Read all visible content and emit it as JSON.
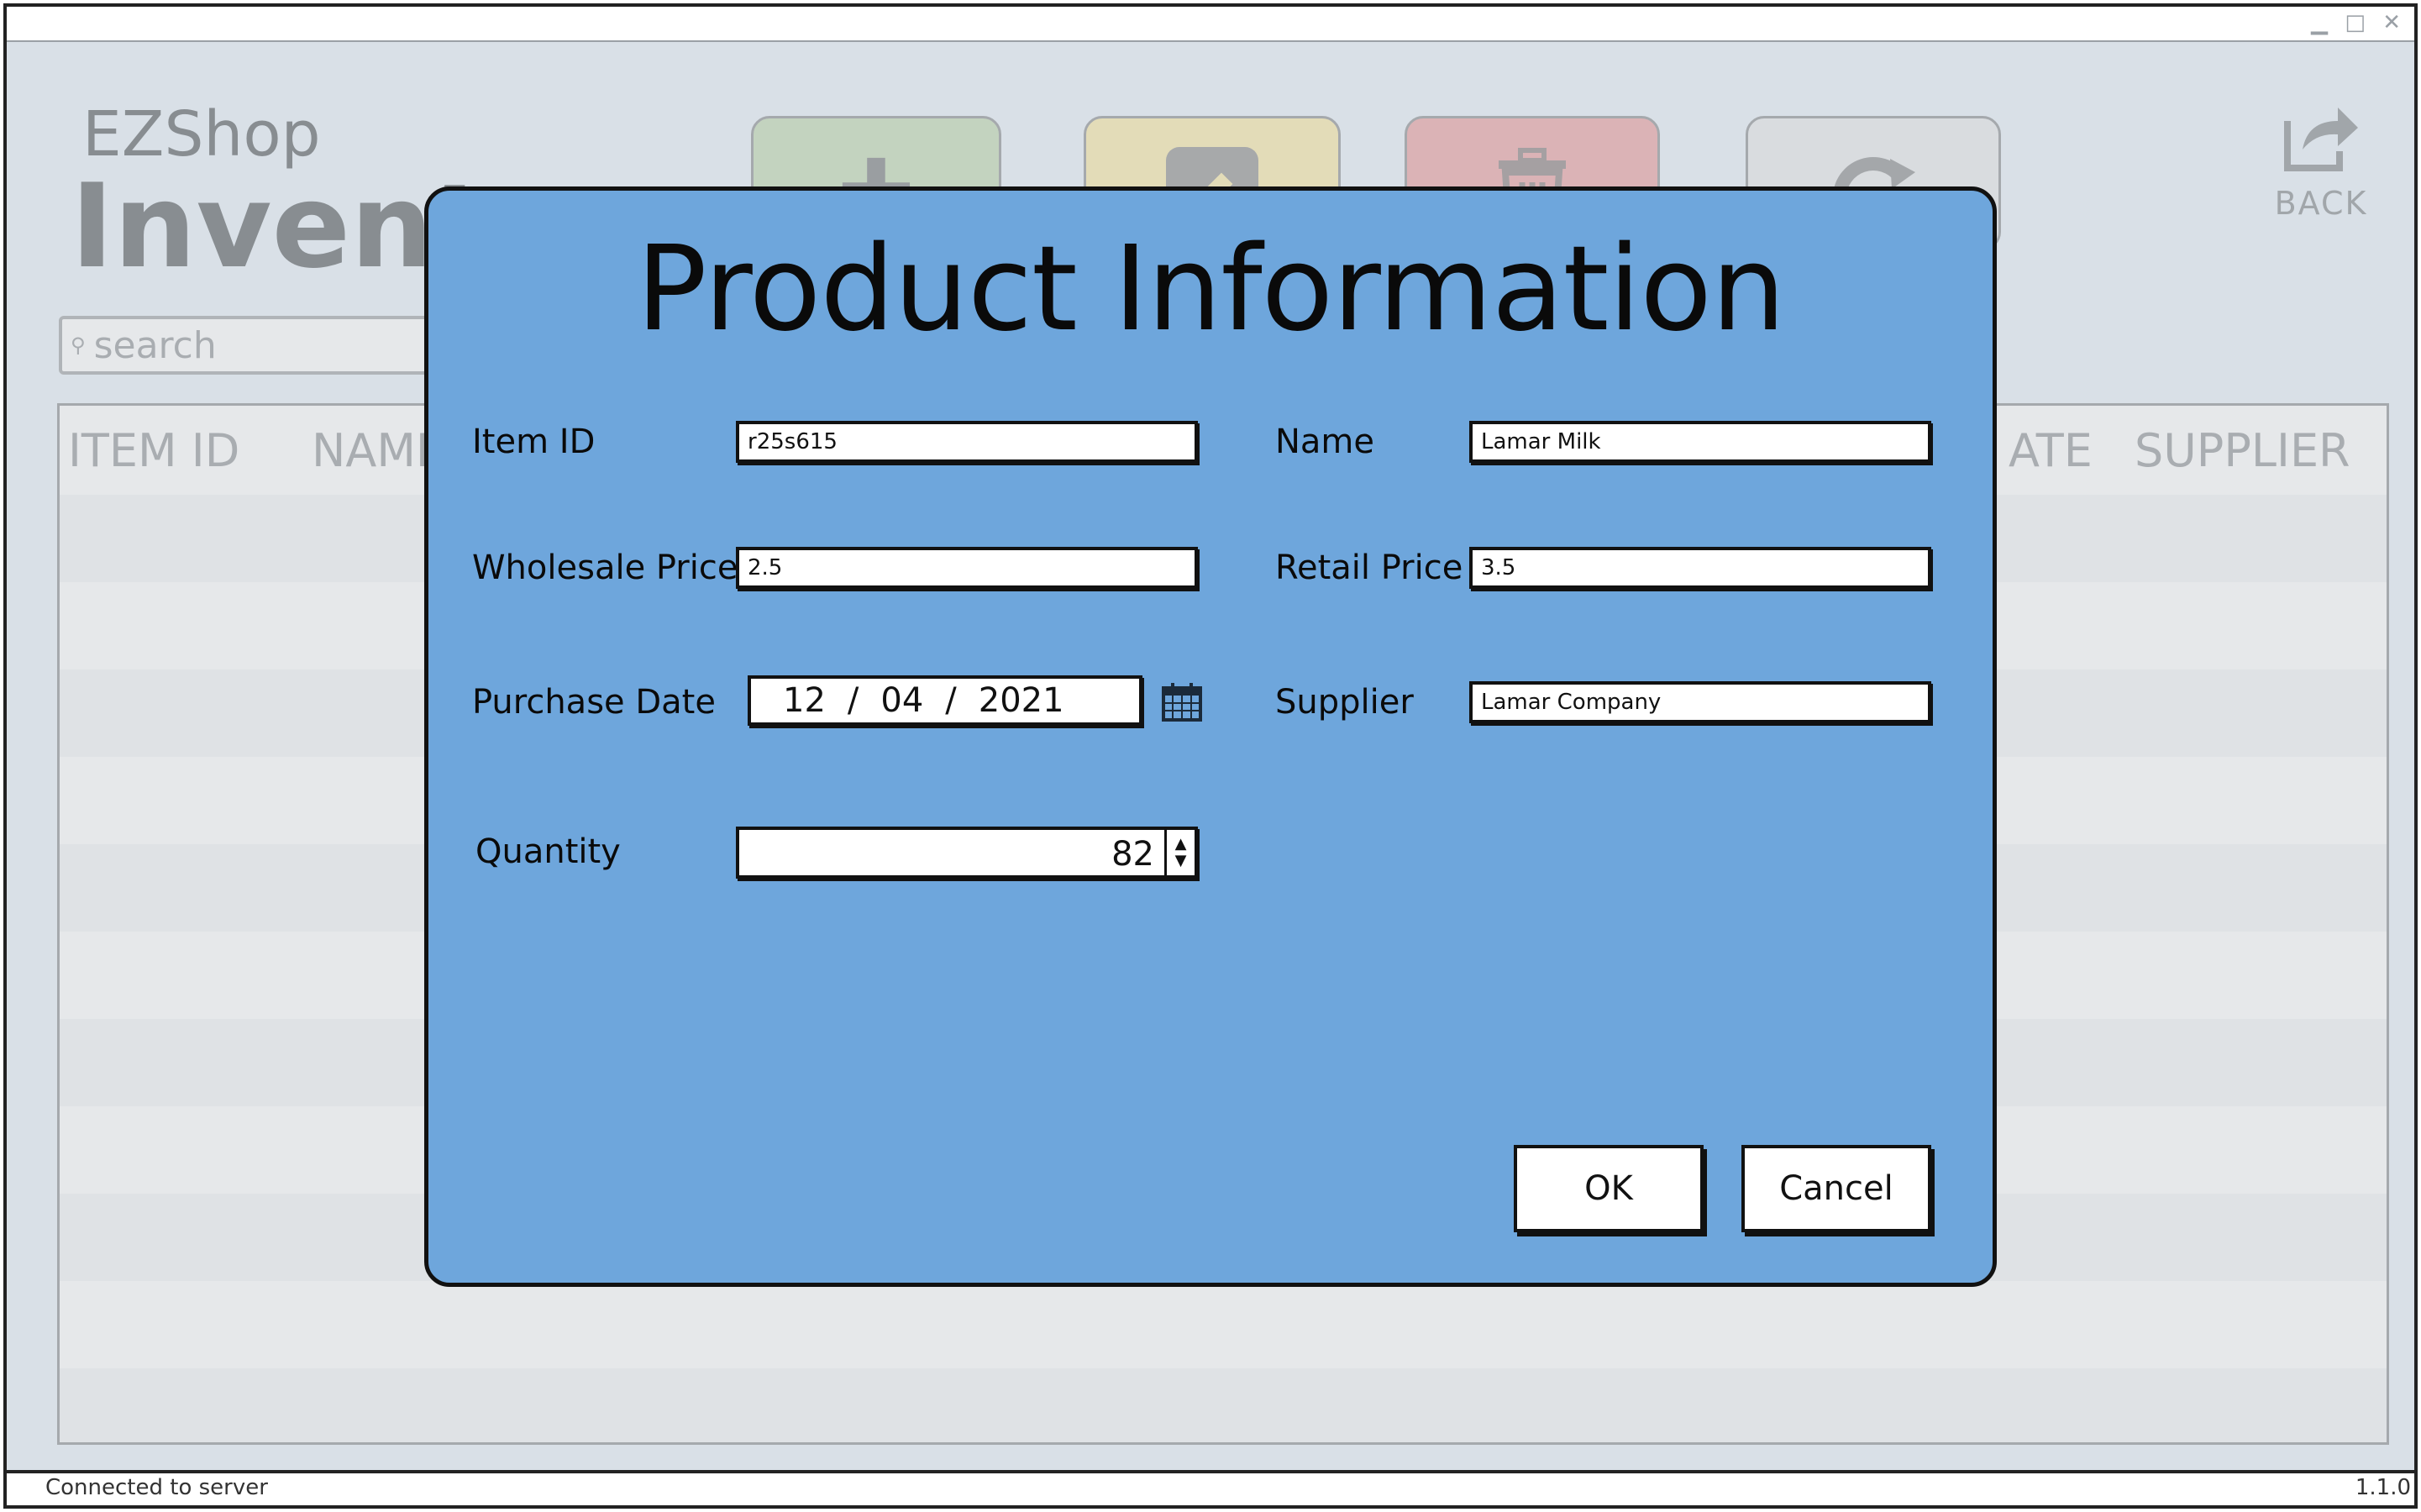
{
  "window": {
    "controls": "▁ □ ✕"
  },
  "app": {
    "brand": "EZShop",
    "title": "Inventory"
  },
  "toolbar": {
    "add_icon": "plus-icon",
    "edit_icon": "pencil-icon",
    "delete_icon": "trash-icon",
    "refresh_icon": "refresh-icon",
    "back_label": "BACK",
    "colors": {
      "add": "#c3d3bf",
      "edit": "#e3dcb8",
      "delete": "#dbb3b6",
      "refresh": "#d9dcdf"
    }
  },
  "search": {
    "placeholder": "search"
  },
  "table": {
    "columns": [
      "ITEM ID",
      "NAME",
      "DATE",
      "SUPPLIER"
    ],
    "visible_headers": {
      "item_id": "ITEM ID",
      "name": "NAME",
      "date_fragment": "ATE",
      "supplier": "SUPPLIER"
    }
  },
  "status": {
    "connection": "Connected to server",
    "version": "1.1.0"
  },
  "dialog": {
    "title": "Product Information",
    "background": "#6ea6dc",
    "fields": {
      "item_id": {
        "label": "Item ID",
        "value": "r25s615"
      },
      "name": {
        "label": "Name",
        "value": "Lamar Milk"
      },
      "wholesale_price": {
        "label": "Wholesale Price",
        "value": "2.5"
      },
      "retail_price": {
        "label": "Retail Price",
        "value": "3.5"
      },
      "purchase_date": {
        "label": "Purchase Date",
        "month": "12",
        "day": "04",
        "year": "2021"
      },
      "supplier": {
        "label": "Supplier",
        "value": "Lamar Company"
      },
      "quantity": {
        "label": "Quantity",
        "value": "82"
      }
    },
    "buttons": {
      "ok": "OK",
      "cancel": "Cancel"
    }
  }
}
